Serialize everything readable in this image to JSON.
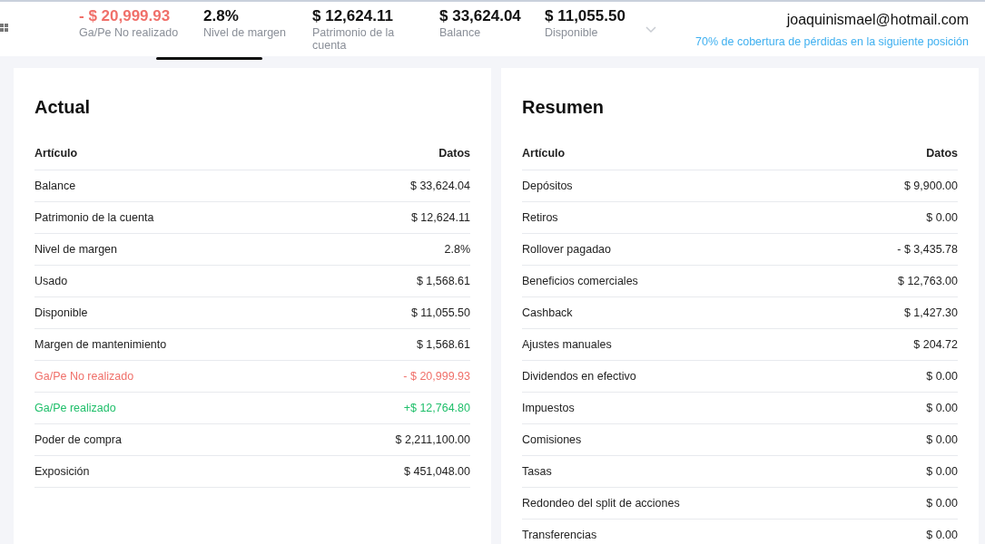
{
  "header": {
    "metrics": [
      {
        "value": "- $ 20,999.93",
        "label": "Ga/Pe No realizado",
        "kind": "loss"
      },
      {
        "value": "2.8%",
        "label": "Nivel de margen",
        "kind": "normal"
      },
      {
        "value": "$ 12,624.11",
        "label": "Patrimonio de la cuenta",
        "kind": "normal"
      },
      {
        "value": "$ 33,624.04",
        "label": "Balance",
        "kind": "normal"
      },
      {
        "value": "$ 11,055.50",
        "label": "Disponible",
        "kind": "normal"
      }
    ],
    "account": {
      "email": "joaquinismael@hotmail.com",
      "coverage": "70% de cobertura de pérdidas en la siguiente posición"
    }
  },
  "panels": [
    {
      "title": "Actual",
      "columns": [
        "Artículo",
        "Datos"
      ],
      "rows": [
        {
          "item": "Balance",
          "value": "$ 33,624.04",
          "kind": "normal"
        },
        {
          "item": "Patrimonio de la cuenta",
          "value": "$ 12,624.11",
          "kind": "normal"
        },
        {
          "item": "Nivel de margen",
          "value": "2.8%",
          "kind": "normal"
        },
        {
          "item": "Usado",
          "value": "$ 1,568.61",
          "kind": "normal"
        },
        {
          "item": "Disponible",
          "value": "$ 11,055.50",
          "kind": "normal"
        },
        {
          "item": "Margen de mantenimiento",
          "value": "$ 1,568.61",
          "kind": "normal"
        },
        {
          "item": "Ga/Pe No realizado",
          "value": "- $ 20,999.93",
          "kind": "loss"
        },
        {
          "item": "Ga/Pe realizado",
          "value": "+$ 12,764.80",
          "kind": "gain"
        },
        {
          "item": "Poder de compra",
          "value": "$ 2,211,100.00",
          "kind": "normal"
        },
        {
          "item": "Exposición",
          "value": "$ 451,048.00",
          "kind": "normal"
        }
      ]
    },
    {
      "title": "Resumen",
      "columns": [
        "Artículo",
        "Datos"
      ],
      "rows": [
        {
          "item": "Depósitos",
          "value": "$ 9,900.00",
          "kind": "normal"
        },
        {
          "item": "Retiros",
          "value": "$ 0.00",
          "kind": "normal"
        },
        {
          "item": "Rollover pagadao",
          "value": "- $ 3,435.78",
          "kind": "normal"
        },
        {
          "item": "Beneficios comerciales",
          "value": "$ 12,763.00",
          "kind": "normal"
        },
        {
          "item": "Cashback",
          "value": "$ 1,427.30",
          "kind": "normal"
        },
        {
          "item": "Ajustes manuales",
          "value": "$ 204.72",
          "kind": "normal"
        },
        {
          "item": "Dividendos en efectivo",
          "value": "$ 0.00",
          "kind": "normal"
        },
        {
          "item": "Impuestos",
          "value": "$ 0.00",
          "kind": "normal"
        },
        {
          "item": "Comisiones",
          "value": "$ 0.00",
          "kind": "normal"
        },
        {
          "item": "Tasas",
          "value": "$ 0.00",
          "kind": "normal"
        },
        {
          "item": "Redondeo del split de acciones",
          "value": "$ 0.00",
          "kind": "normal"
        },
        {
          "item": "Transferencias",
          "value": "$ 0.00",
          "kind": "normal"
        }
      ]
    }
  ]
}
